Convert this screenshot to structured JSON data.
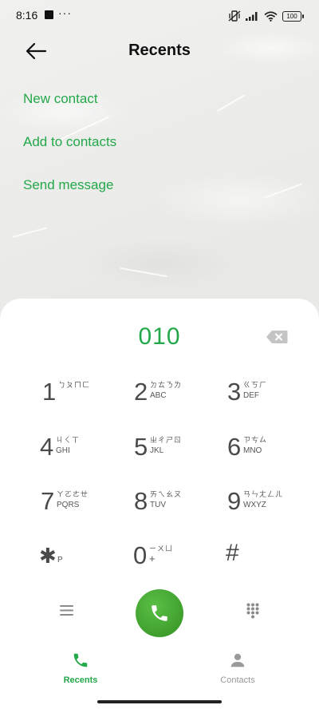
{
  "status_bar": {
    "time": "8:16",
    "dots": "···",
    "battery": "100"
  },
  "header": {
    "title": "Recents"
  },
  "actions": [
    {
      "label": "New contact"
    },
    {
      "label": "Add to contacts"
    },
    {
      "label": "Send message"
    }
  ],
  "dialer": {
    "number": "010",
    "keys": [
      {
        "digit": "1",
        "zhuyin": "ㄅㄆㄇㄈ",
        "letters": ""
      },
      {
        "digit": "2",
        "zhuyin": "ㄉㄊㄋㄌ",
        "letters": "ABC"
      },
      {
        "digit": "3",
        "zhuyin": "ㄍㄎㄏ",
        "letters": "DEF"
      },
      {
        "digit": "4",
        "zhuyin": "ㄐㄑㄒ",
        "letters": "GHI"
      },
      {
        "digit": "5",
        "zhuyin": "ㄓㄔㄕㄖ",
        "letters": "JKL"
      },
      {
        "digit": "6",
        "zhuyin": "ㄗㄘㄙ",
        "letters": "MNO"
      },
      {
        "digit": "7",
        "zhuyin": "ㄚㄛㄜㄝ",
        "letters": "PQRS"
      },
      {
        "digit": "8",
        "zhuyin": "ㄞㄟㄠㄡ",
        "letters": "TUV"
      },
      {
        "digit": "9",
        "zhuyin": "ㄢㄣㄤㄥㄦ",
        "letters": "WXYZ"
      },
      {
        "digit": "0",
        "zhuyin": "ㄧㄨㄩ",
        "letters": "+"
      }
    ],
    "star": {
      "symbol": "✱",
      "sub": "P"
    },
    "hash": {
      "symbol": "#"
    }
  },
  "bottom_nav": {
    "tabs": [
      {
        "label": "Recents",
        "active": true
      },
      {
        "label": "Contacts",
        "active": false
      }
    ]
  },
  "colors": {
    "accent": "#23a84a",
    "call": "#43a632",
    "inactive": "#9a9a9a"
  }
}
